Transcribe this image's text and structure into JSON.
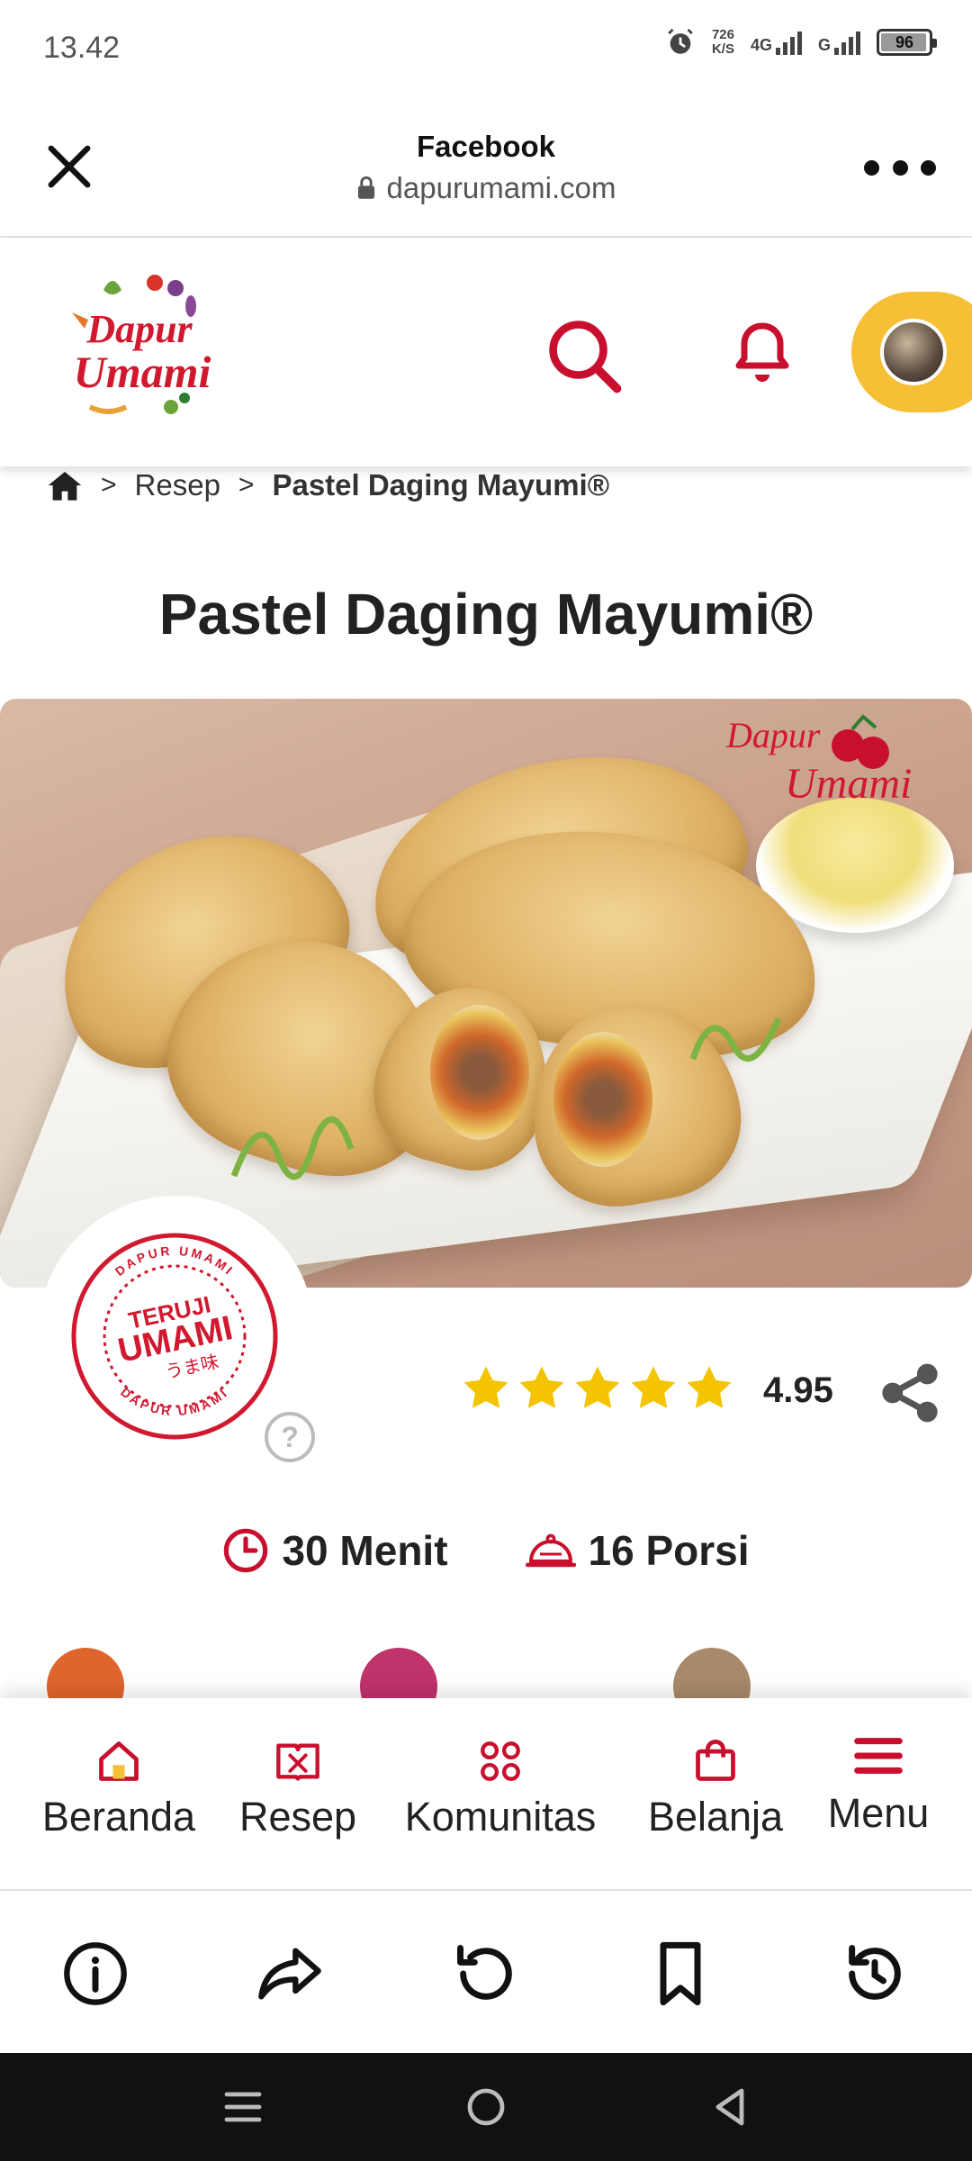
{
  "status_bar": {
    "time": "13.42",
    "speed_value": "726",
    "speed_unit": "K/S",
    "network_4g": "4G",
    "network_g": "G",
    "battery": "96",
    "battery_level": 0.96
  },
  "browser": {
    "title": "Facebook",
    "url": "dapurumami.com"
  },
  "site": {
    "logo_line1": "Dapur",
    "logo_line2": "Umami"
  },
  "breadcrumb": {
    "items": [
      "Resep",
      "Pastel Daging Mayumi®"
    ],
    "separator": ">"
  },
  "recipe": {
    "title": "Pastel Daging Mayumi®",
    "image_logo_line1": "Dapur",
    "image_logo_line2": "Umami",
    "badge_top_text": "DAPUR UMAMI",
    "badge_line1": "TERUJI",
    "badge_line2": "UMAMI",
    "badge_line3": "うま味",
    "help_symbol": "?",
    "stars": 5,
    "rating": "4.95",
    "time": "30 Menit",
    "portions": "16 Porsi"
  },
  "colors": {
    "brand_red": "#c8102e",
    "pill_yellow": "#f6bf36",
    "star_yellow": "#f4c400",
    "info_orange": "#e0652c",
    "info_magenta": "#c0336b",
    "info_brown": "#a88a6a"
  },
  "bottom_nav": {
    "items": [
      {
        "label": "Beranda",
        "icon": "home-icon"
      },
      {
        "label": "Resep",
        "icon": "recipe-book-icon"
      },
      {
        "label": "Komunitas",
        "icon": "community-icon"
      },
      {
        "label": "Belanja",
        "icon": "shopping-bag-icon"
      },
      {
        "label": "Menu",
        "icon": "hamburger-menu-icon"
      }
    ]
  },
  "browser_toolbar": {
    "items": [
      "info-icon",
      "forward-icon",
      "refresh-icon",
      "bookmark-icon",
      "history-icon"
    ]
  },
  "system_nav": {
    "items": [
      "recents-icon",
      "home-circle-icon",
      "back-triangle-icon"
    ]
  }
}
